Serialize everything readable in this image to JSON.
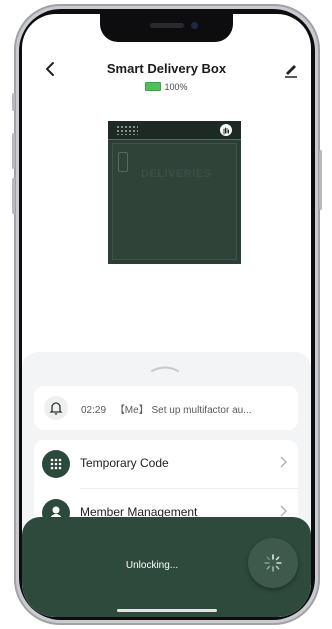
{
  "header": {
    "title": "Smart Delivery Box",
    "battery_text": "100%"
  },
  "device": {
    "label": "DELIVERIES"
  },
  "log": {
    "time": "02:29",
    "text": "【Me】 Set up multifactor au..."
  },
  "menu": {
    "items": [
      {
        "label": "Temporary Code",
        "icon": "keypad-icon"
      },
      {
        "label": "Member Management",
        "icon": "user-icon"
      }
    ]
  },
  "toast": {
    "text": "Unlocking..."
  },
  "colors": {
    "accent": "#2e4a3c",
    "battery": "#4fbf5a"
  }
}
